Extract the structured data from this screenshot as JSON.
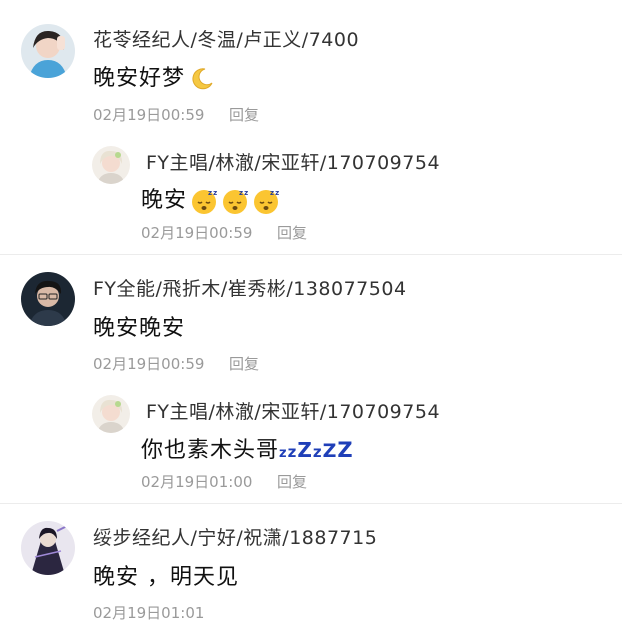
{
  "comments": [
    {
      "name": "花苓经纪人/冬温/卢正义/7400",
      "text": "晚安好梦",
      "emoji": "crescent-moon",
      "time": "02月19日00:59",
      "reply_label": "回复",
      "replies": [
        {
          "name": "FY主唱/林澈/宋亚轩/170709754",
          "text": "晚安",
          "emoji": "sleeping-face x3",
          "time": "02月19日00:59",
          "reply_label": "回复"
        }
      ]
    },
    {
      "name": "FY全能/飛折木/崔秀彬/138077504",
      "text": "晚安晚安",
      "time": "02月19日00:59",
      "reply_label": "回复",
      "replies": [
        {
          "name": "FY主唱/林澈/宋亚轩/170709754",
          "text": "你也素木头哥",
          "suffix": "zzZzZZ",
          "time": "02月19日01:00",
          "reply_label": "回复"
        }
      ]
    },
    {
      "name": "绥步经纪人/宁好/祝潇/1887715",
      "text": "晚安 ，明天见",
      "time": "02月19日01:01"
    }
  ],
  "colors": {
    "zzz_blue": "#1f3fb8",
    "meta_gray": "#9a9a9a",
    "divider": "#ececec"
  }
}
